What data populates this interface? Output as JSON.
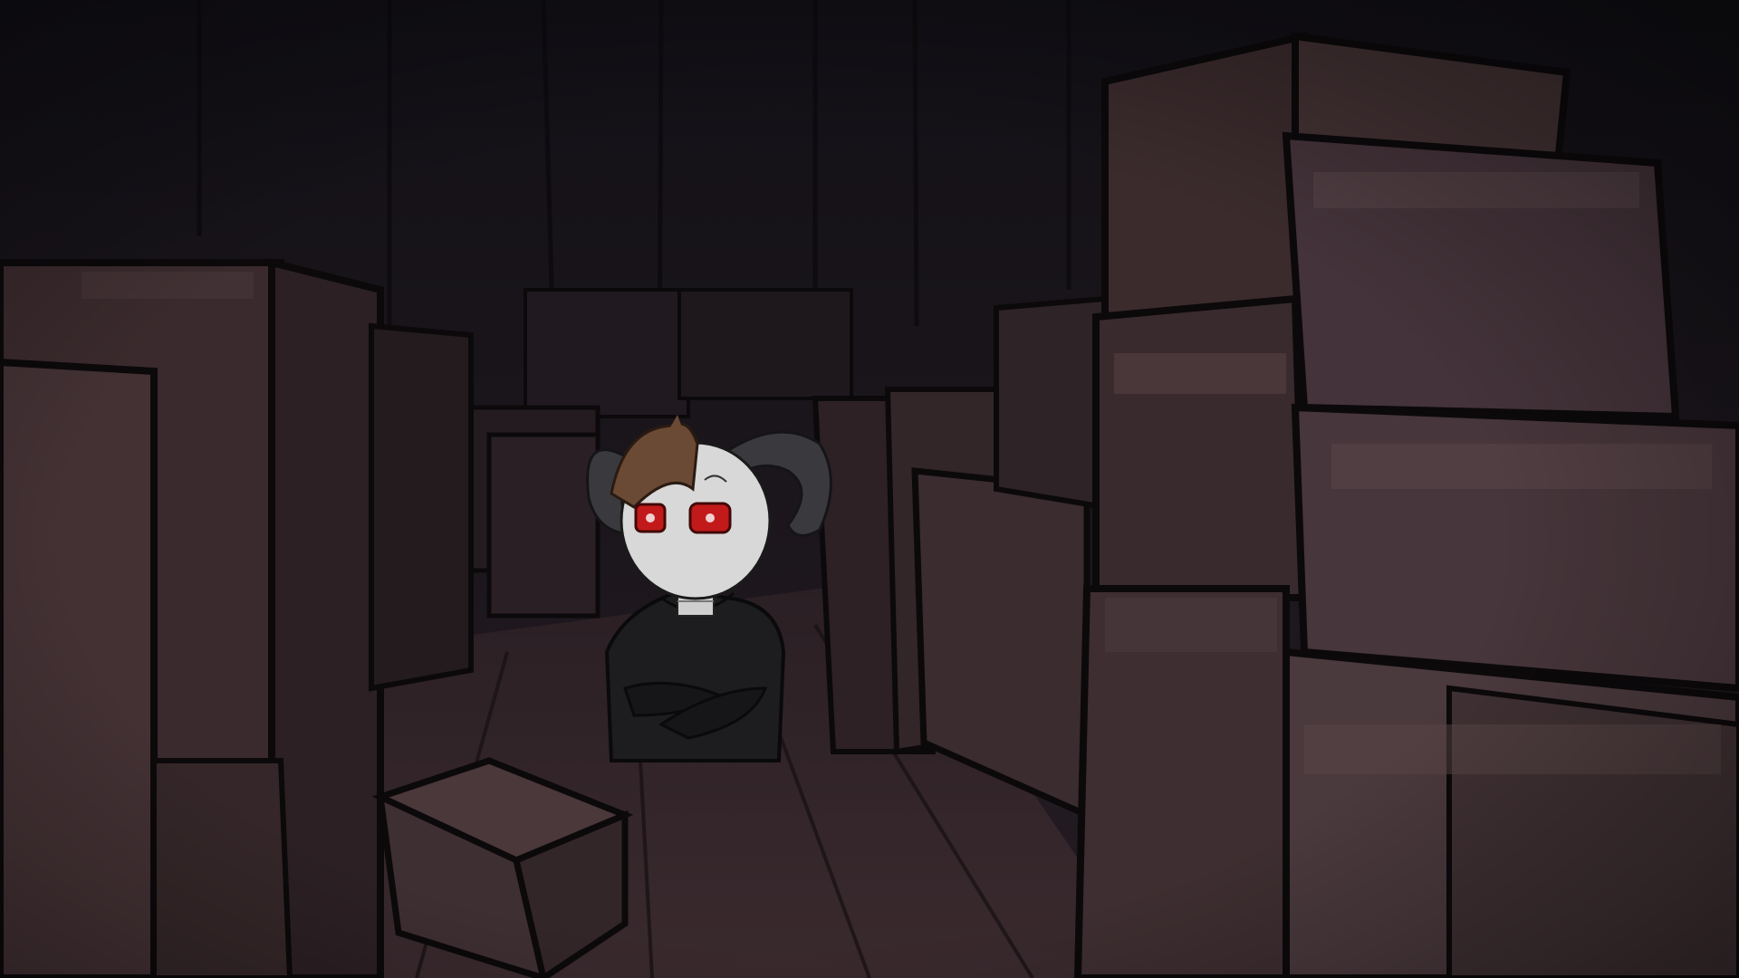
{
  "scene": {
    "name": "storage-room",
    "palette": {
      "wall_dark": "#16131a",
      "wall_mid": "#1f1a22",
      "box_face": "#3a2a2c",
      "box_light": "#4b393b",
      "box_shadow": "#251b1e",
      "floor": "#2c2024",
      "outline": "#0c090b"
    }
  },
  "character": {
    "name": "horned-character",
    "hair_color": "#6b4a35",
    "skin_color": "#d8d8d8",
    "horn_color": "#3a3a3e",
    "eye_color": "#c21a1a",
    "hoodie_color": "#1d1d1f"
  }
}
